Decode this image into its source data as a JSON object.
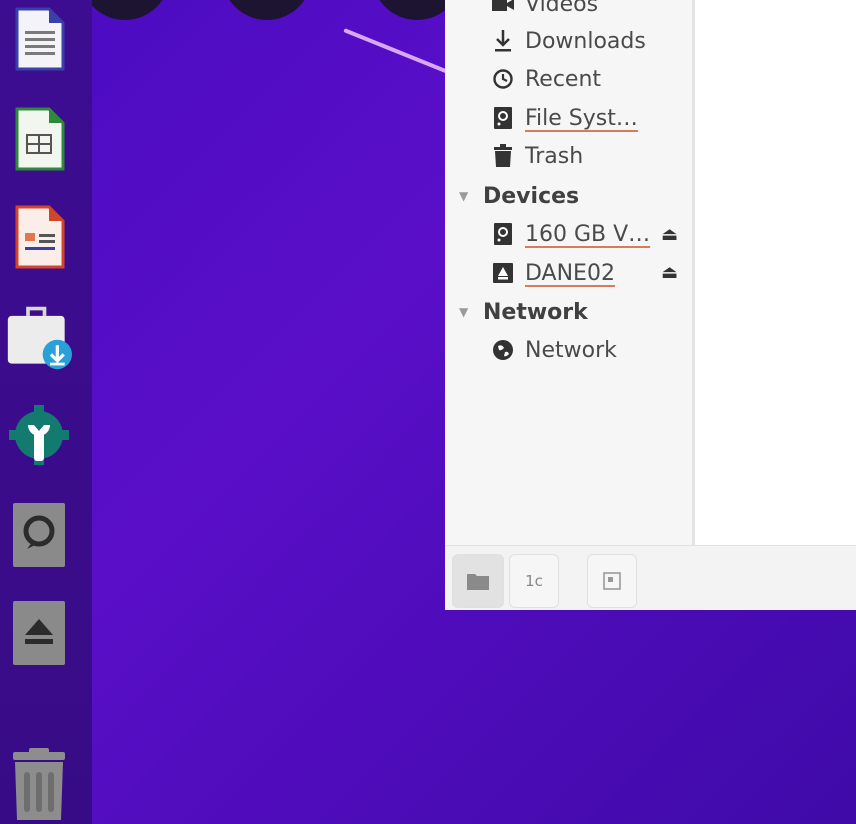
{
  "desktop": {
    "background_color": "#4f0cc0",
    "accent_line_color": "#d8a9f2"
  },
  "dock": {
    "items": [
      {
        "name": "libreoffice-writer",
        "icon": "writer-icon"
      },
      {
        "name": "libreoffice-calc",
        "icon": "calc-icon"
      },
      {
        "name": "libreoffice-impress",
        "icon": "impress-icon"
      },
      {
        "name": "software-install",
        "icon": "software-icon"
      },
      {
        "name": "settings",
        "icon": "settings-icon"
      },
      {
        "name": "drive",
        "icon": "drive-icon"
      },
      {
        "name": "removable-drive",
        "icon": "eject-drive-icon"
      },
      {
        "name": "trash",
        "icon": "trash-icon"
      }
    ]
  },
  "file_manager": {
    "places": [
      {
        "label": "Videos",
        "icon": "video-icon"
      },
      {
        "label": "Downloads",
        "icon": "download-icon"
      },
      {
        "label": "Recent",
        "icon": "clock-icon"
      },
      {
        "label": "File Syst…",
        "icon": "harddisk-icon"
      },
      {
        "label": "Trash",
        "icon": "trash-icon"
      }
    ],
    "devices_header": "Devices",
    "devices": [
      {
        "label": "160 GB V…",
        "icon": "harddisk-icon",
        "eject": "⏏"
      },
      {
        "label": "DANE02",
        "icon": "usb-drive-icon",
        "eject": "⏏"
      }
    ],
    "network_header": "Network",
    "network": [
      {
        "label": "Network",
        "icon": "globe-icon"
      }
    ],
    "bottom_bar": {
      "folder_button": "folder-icon",
      "text_button": "1c",
      "preview_button": "preview-icon"
    }
  }
}
